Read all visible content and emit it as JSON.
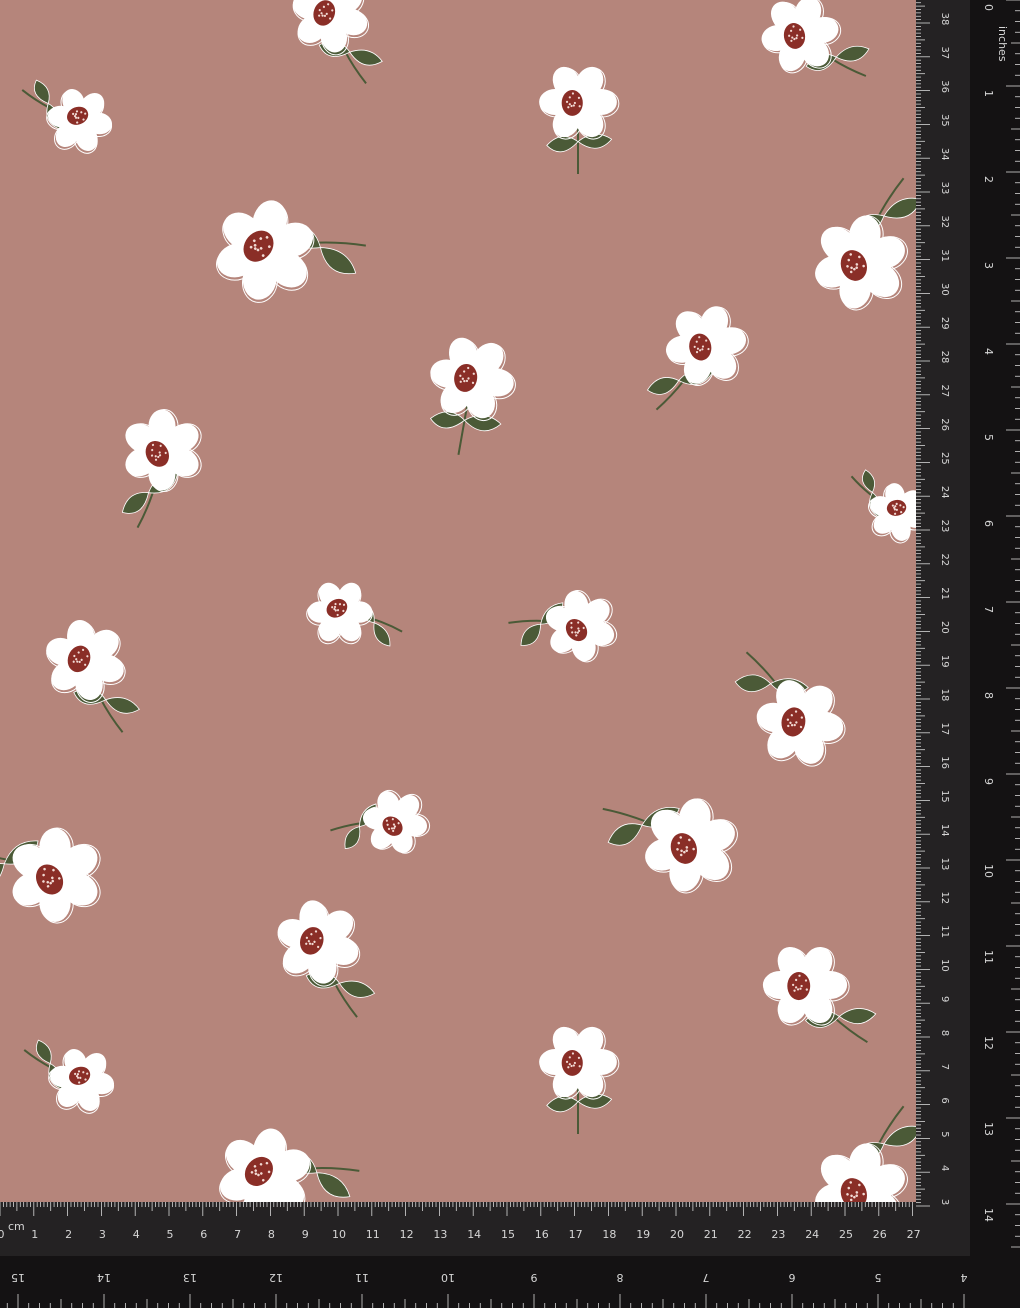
{
  "colors": {
    "background": "#b5857b",
    "petal": "#ffffff",
    "center": "#8a2e27",
    "leaf": "#4b5a37",
    "ruler_dark": "#141213",
    "ruler_mid": "#242223",
    "ruler_text": "#d6d6d6"
  },
  "pattern": {
    "motif": "white daisy with dark red speckled center and green leaves"
  },
  "right_ruler": {
    "unit_label": "inches",
    "inch_labels": [
      "0",
      "1",
      "2",
      "3",
      "4",
      "5",
      "6",
      "7",
      "8",
      "9",
      "10",
      "11",
      "12",
      "13",
      "14"
    ],
    "cm_labels": [
      "38",
      "37",
      "36",
      "35",
      "34",
      "33",
      "32",
      "31",
      "30",
      "29",
      "28",
      "27",
      "26",
      "25",
      "24",
      "23",
      "22",
      "21",
      "20",
      "19",
      "18",
      "17",
      "16",
      "15",
      "14",
      "13",
      "12",
      "11",
      "10",
      "9",
      "8",
      "7",
      "6",
      "5",
      "4",
      "3"
    ]
  },
  "bottom_ruler": {
    "unit_label": "cm",
    "cm_labels": [
      "0",
      "1",
      "2",
      "3",
      "4",
      "5",
      "6",
      "7",
      "8",
      "9",
      "10",
      "11",
      "12",
      "13",
      "14",
      "15",
      "16",
      "17",
      "18",
      "19",
      "20",
      "21",
      "22",
      "23",
      "24",
      "25",
      "26",
      "27"
    ],
    "inch_labels": [
      "15",
      "14",
      "13",
      "12",
      "11",
      "10",
      "9",
      "8",
      "7",
      "6",
      "5",
      "4"
    ]
  }
}
